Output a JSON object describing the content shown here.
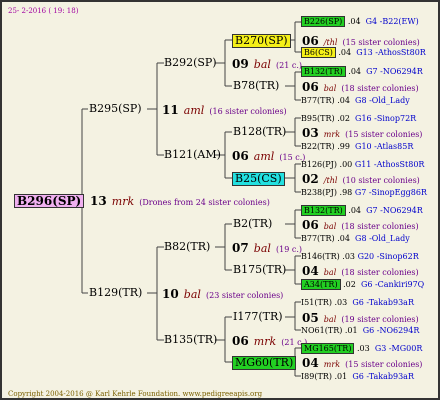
{
  "date": "25- 2-2016 ( 19: 18)",
  "copyright": "Copyright 2004-2016 @ Karl Kehrle Foundation.   www.pedigreeapis.org",
  "colors": {
    "yellow": "#f5f018",
    "green": "#22d022",
    "cyan": "#22e0e0",
    "pink": "#f0b0f0",
    "code": "#7a0000",
    "sub": "#6a008a",
    "extra": "#0000cc"
  },
  "root": {
    "name": "B296(SP)",
    "num": "13",
    "code": "mrk",
    "sub": "(Drones from 24 sister colonies)"
  },
  "g1": [
    {
      "name": "B295(SP)",
      "num": "11",
      "code": "aml",
      "sub": "(16 sister colonies)"
    },
    {
      "name": "B129(TR)",
      "num": "10",
      "code": "bal",
      "sub": "(23 sister colonies)"
    }
  ],
  "g2": [
    {
      "name": "B292(SP)",
      "num": "09",
      "code": "bal",
      "sub": "(21 c.)"
    },
    {
      "name": "B121(AM)",
      "num": "06",
      "code": "aml",
      "sub": "(15 c.)"
    },
    {
      "name": "B82(TR)",
      "num": "07",
      "code": "bal",
      "sub": "(19 c.)"
    },
    {
      "name": "B135(TR)",
      "num": "06",
      "code": "mrk",
      "sub": "(21 c.)"
    }
  ],
  "g3": [
    {
      "name": "B270(SP)",
      "num": "06",
      "code": "/thl",
      "sub": "(15 sister colonies)"
    },
    {
      "name": "B78(TR)",
      "num": "06",
      "code": "bal",
      "sub": "(18 sister colonies)"
    },
    {
      "name": "B128(TR)",
      "num": "03",
      "code": "mrk",
      "sub": "(15 sister colonies)"
    },
    {
      "name": "B25(CS)",
      "num": "02",
      "code": "/thl",
      "sub": "(10 sister colonies)"
    },
    {
      "name": "B2(TR)",
      "num": "06",
      "code": "bal",
      "sub": "(18 sister colonies)"
    },
    {
      "name": "B175(TR)",
      "num": "04",
      "code": "bal",
      "sub": "(18 sister colonies)"
    },
    {
      "name": "I177(TR)",
      "num": "05",
      "code": "bal",
      "sub": "(19 sister colonies)"
    },
    {
      "name": "MG60(TR)",
      "num": "04",
      "code": "mrk",
      "sub": "(15 sister colonies)"
    }
  ],
  "g4": [
    {
      "name": "B226(SP)",
      "val": ".04",
      "extra": "G4 -B22(EW)"
    },
    {
      "name": "B6(CS)",
      "val": ".04",
      "extra": "G13 -AthosSt80R"
    },
    {
      "name": "B132(TR)",
      "val": ".04",
      "extra": "G7 -NO6294R"
    },
    {
      "name": "B77(TR)",
      "val": ".04",
      "extra": "G8 -Old_Lady"
    },
    {
      "name": "B95(TR)",
      "val": ".02",
      "extra": "G16 -Sinop72R"
    },
    {
      "name": "B22(TR)",
      "val": ".99",
      "extra": "G10 -Atlas85R"
    },
    {
      "name": "B126(PJ)",
      "val": ".00",
      "extra": "G11 -AthosSt80R"
    },
    {
      "name": "B238(PJ)",
      "val": ".98",
      "extra": "G7 -SinopEgg86R"
    },
    {
      "name": "B132(TR)",
      "val": ".04",
      "extra": "G7 -NO6294R"
    },
    {
      "name": "B77(TR)",
      "val": ".04",
      "extra": "G8 -Old_Lady"
    },
    {
      "name": "B146(TR)",
      "val": ".03",
      "extra": "G20 -Sinop62R"
    },
    {
      "name": "A34(TR)",
      "val": ".02",
      "extra": "G6 -Cankiri97Q"
    },
    {
      "name": "I51(TR)",
      "val": ".03",
      "extra": "G6 -Takab93aR"
    },
    {
      "name": "NO61(TR)",
      "val": ".01",
      "extra": "G6 -NO6294R"
    },
    {
      "name": "MG165(TR)",
      "val": ".03",
      "extra": "G3 -MG00R"
    },
    {
      "name": "I89(TR)",
      "val": ".01",
      "extra": "G6 -Takab93aR"
    }
  ]
}
